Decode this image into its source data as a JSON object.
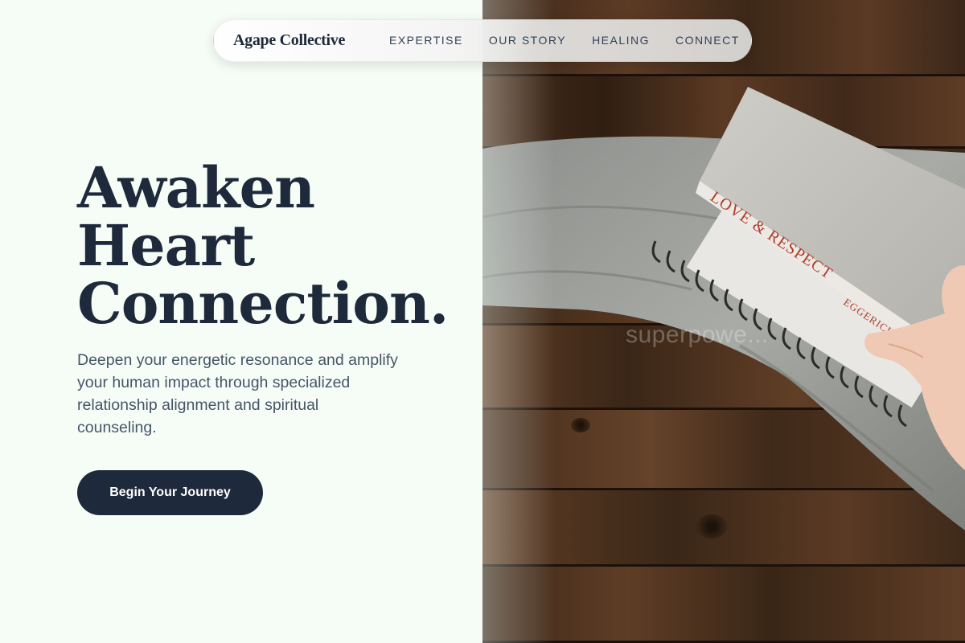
{
  "nav": {
    "brand": "Agape Collective",
    "links": [
      "EXPERTISE",
      "OUR STORY",
      "HEALING",
      "CONNECT"
    ]
  },
  "hero": {
    "title_lines": [
      "Awaken",
      "Heart",
      "Connection."
    ],
    "subtitle": "Deepen your energetic resonance and amplify your human impact through specialized relationship alignment and spiritual counseling.",
    "cta_label": "Begin Your Journey"
  },
  "photo": {
    "book_title": "LOVE & RESPECT",
    "book_author": "EGGERICHS",
    "watermark": "superpowe..."
  },
  "colors": {
    "page_bg": "#f5fdf6",
    "primary": "#1e293b",
    "text_muted": "#475569"
  }
}
